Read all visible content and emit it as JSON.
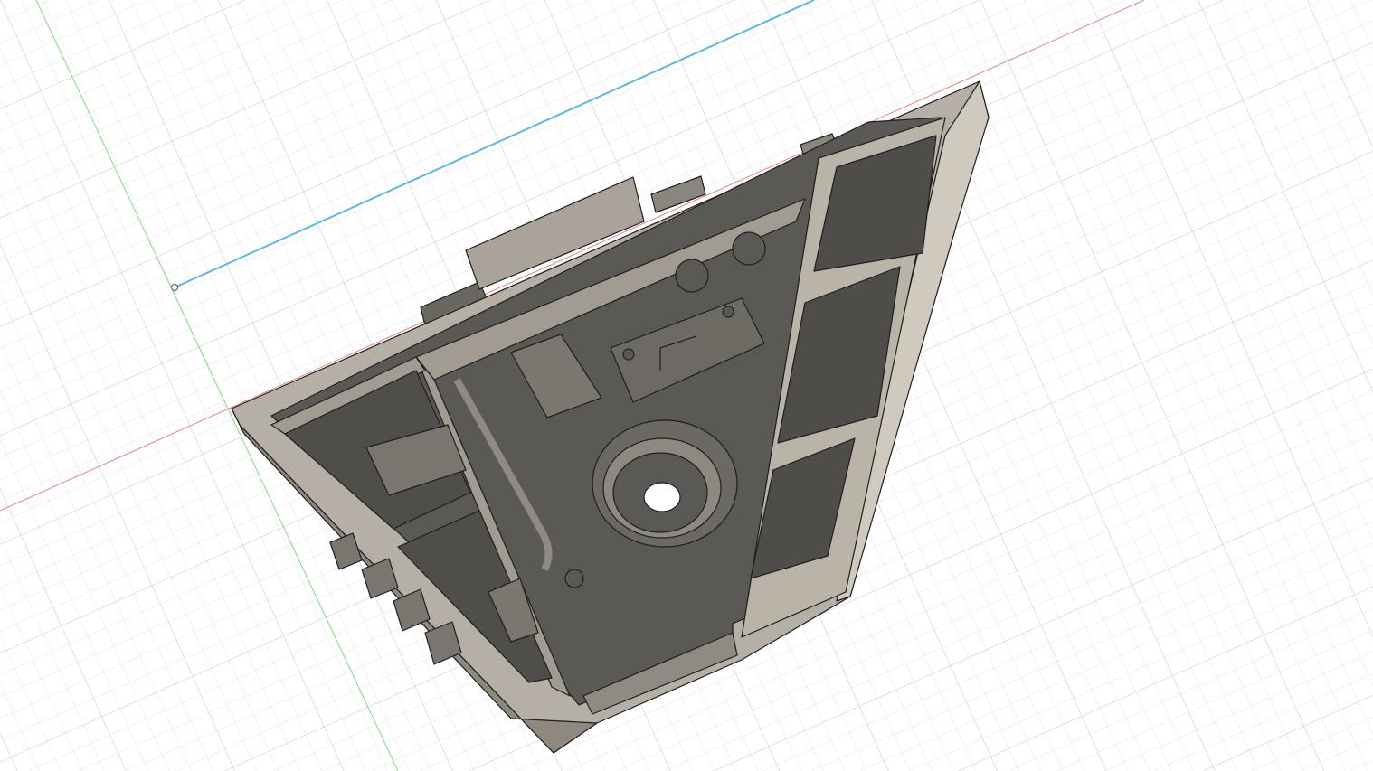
{
  "viewport": {
    "kind": "3D CAD modeling canvas",
    "background_color": "#ffffff",
    "grid_minor_color": "#e6e6e6",
    "grid_major_color": "#cfcfcf",
    "axis_colors": {
      "x": "#f08080",
      "y": "#7de07d",
      "z": "#5bb8e6"
    },
    "model": {
      "body_color": "#5b5955",
      "rim_color": "#b5afa5",
      "edge_color": "#1e1e1e",
      "icon": "3d-body-icon"
    },
    "origin_icon": "origin-point-icon"
  }
}
